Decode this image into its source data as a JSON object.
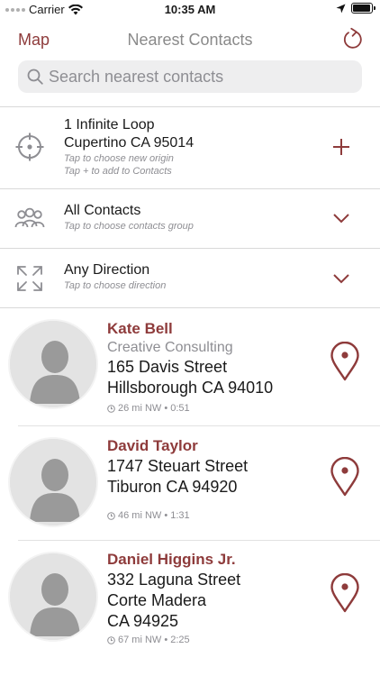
{
  "status_bar": {
    "carrier": "Carrier",
    "time": "10:35 AM",
    "battery_level": 0.95
  },
  "nav": {
    "map_label": "Map",
    "title": "Nearest Contacts"
  },
  "search": {
    "placeholder": "Search nearest contacts"
  },
  "origin": {
    "line1": "1 Infinite Loop",
    "line2": "Cupertino CA 95014",
    "hint1": "Tap to choose new origin",
    "hint2": "Tap + to add to Contacts"
  },
  "group": {
    "label": "All Contacts",
    "hint": "Tap to choose contacts group"
  },
  "direction": {
    "label": "Any Direction",
    "hint": "Tap to choose direction"
  },
  "contacts": [
    {
      "name": "Kate Bell",
      "company": "Creative Consulting",
      "lines": [
        "165 Davis Street",
        "Hillsborough CA 94010"
      ],
      "meta": "26 mi NW • 0:51"
    },
    {
      "name": "David Taylor",
      "lines": [
        "1747 Steuart Street",
        "Tiburon CA 94920"
      ],
      "meta": "46 mi NW • 1:31"
    },
    {
      "name": "Daniel Higgins Jr.",
      "lines": [
        "332 Laguna Street",
        "Corte Madera",
        "CA 94925"
      ],
      "meta": "67 mi NW • 2:25"
    }
  ],
  "colors": {
    "accent": "#8e3b3b",
    "secondary_text": "#8e8e93",
    "search_bg": "#eeeeef"
  }
}
